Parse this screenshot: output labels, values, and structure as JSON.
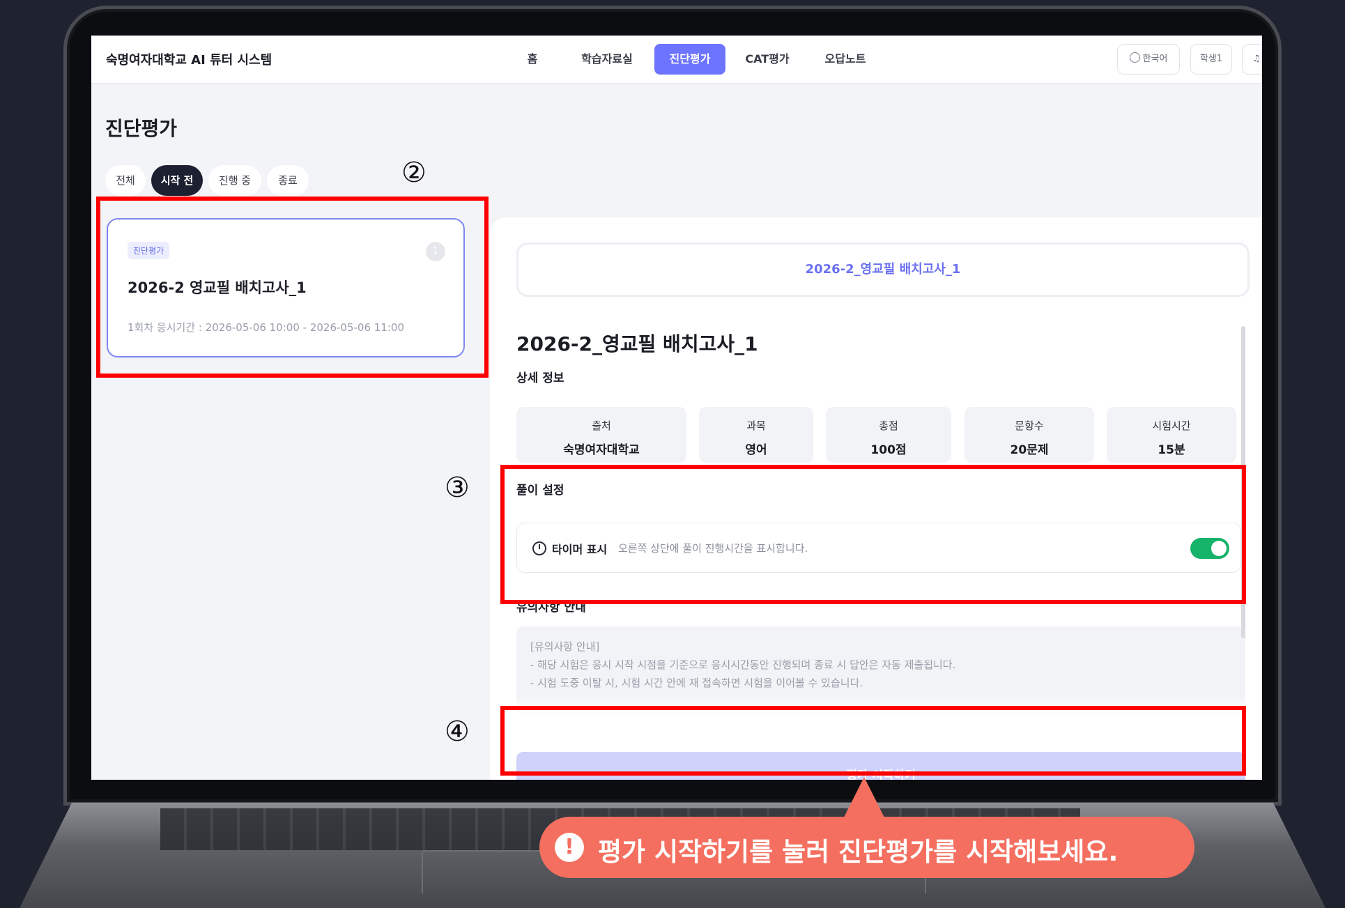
{
  "app": {
    "title": "숙명여자대학교 AI 튜터 시스템"
  },
  "nav": {
    "items": [
      {
        "label": "홈"
      },
      {
        "label": "학습자료실"
      },
      {
        "label": "진단평가"
      },
      {
        "label": "CAT평가"
      },
      {
        "label": "오답노트"
      }
    ],
    "active": "진단평가",
    "language_label": "한국어",
    "user_label": "학생1"
  },
  "page": {
    "title": "진단평가"
  },
  "filters": [
    "전체",
    "시작 전",
    "진행 중",
    "종료"
  ],
  "exam_card": {
    "tag": "진단평가",
    "count": "1",
    "title": "2026-2 영교필 배치고사_1",
    "period": "1회차 응시기간 : 2026-05-06 10:00 - 2026-05-06 11:00"
  },
  "detail": {
    "header": "2026-2_영교필 배치고사_1",
    "title": "2026-2_영교필 배치고사_1",
    "info_label": "상세 정보",
    "info": [
      {
        "key": "출처",
        "value": "숙명여자대학교"
      },
      {
        "key": "과목",
        "value": "영어"
      },
      {
        "key": "총점",
        "value": "100점"
      },
      {
        "key": "문항수",
        "value": "20문제"
      },
      {
        "key": "시험시간",
        "value": "15분"
      }
    ],
    "settings_label": "풀이 설정",
    "timer": {
      "name": "타이머 표시",
      "desc": "오른쪽 상단에 풀이 진행시간을 표시합니다.",
      "enabled": true
    },
    "notice_label": "유의사항 안내",
    "notice_lines": [
      "[유의사항 안내]",
      "- 해당 시험은 응시 시작 시점을 기준으로 응시시간동안 진행되며 종료 시 답안은 자동 제출됩니다.",
      "- 시험 도중 이탈 시, 시험 시간 안에 재 접속하면 시험을 이어볼 수 있습니다."
    ],
    "start_button": "평가 시작하기"
  },
  "annotations": {
    "step2": "②",
    "step3": "③",
    "step4": "④"
  },
  "callout": {
    "icon": "!",
    "text": "평가 시작하기를 눌러 진단평가를 시작해보세요."
  },
  "colors": {
    "accent": "#6d74ff",
    "highlight": "#ff0000",
    "callout": "#f46f5f",
    "toggle_on": "#16b36a"
  }
}
